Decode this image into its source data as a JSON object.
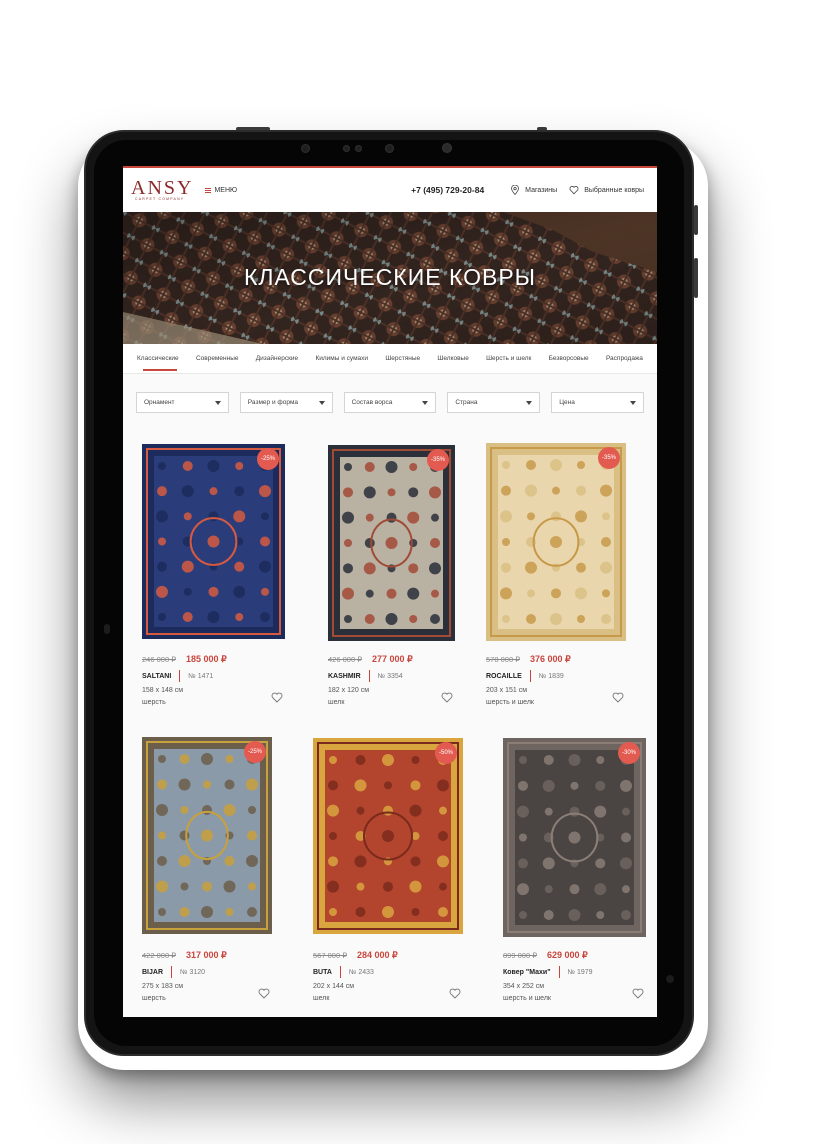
{
  "header": {
    "logo": "ANSY",
    "logo_sub": "CARPET COMPANY",
    "menu_label": "МЕНЮ",
    "phone": "+7 (495) 729-20-84",
    "stores_label": "Магазины",
    "favorites_label": "Выбранные ковры"
  },
  "hero": {
    "title": "КЛАССИЧЕСКИЕ КОВРЫ"
  },
  "categories": [
    "Классические",
    "Современные",
    "Дизайнерские",
    "Килимы и сумахи",
    "Шерстяные",
    "Шелковые",
    "Шерсть и шелк",
    "Безворсовые",
    "Распродажа"
  ],
  "active_category": "Классические",
  "filters": [
    "Орнамент",
    "Размер и форма",
    "Состав ворса",
    "Страна",
    "Цена"
  ],
  "products": [
    {
      "discount": "-25%",
      "old_price": "246 000 ₽",
      "price": "185 000 ₽",
      "name": "SALTANI",
      "number": "№ 1471",
      "size": "158 x 148 см",
      "material": "шерсть",
      "colors": {
        "field": "#2a3d7a",
        "border": "#1c2a5c",
        "accent": "#d65a3f"
      }
    },
    {
      "discount": "-35%",
      "old_price": "426 000 ₽",
      "price": "277 000 ₽",
      "name": "KASHMIR",
      "number": "№ 3354",
      "size": "182 x 120 см",
      "material": "шелк",
      "colors": {
        "field": "#b9b1a2",
        "border": "#2a2f3a",
        "accent": "#a14a36"
      }
    },
    {
      "discount": "-35%",
      "old_price": "578 000 ₽",
      "price": "376 000 ₽",
      "name": "ROCAILLE",
      "number": "№ 1839",
      "size": "203 x 151 см",
      "material": "шерсть и шелк",
      "colors": {
        "field": "#e9d6ad",
        "border": "#d9bf84",
        "accent": "#c79a4a"
      }
    },
    {
      "discount": "-25%",
      "old_price": "422 000 ₽",
      "price": "317 000 ₽",
      "name": "BIJAR",
      "number": "№ 3120",
      "size": "275 x 183 см",
      "material": "шерсть",
      "colors": {
        "field": "#8b9aa8",
        "border": "#6b5e4a",
        "accent": "#c8a03c"
      }
    },
    {
      "discount": "-50%",
      "old_price": "567 000 ₽",
      "price": "284 000 ₽",
      "name": "BUTA",
      "number": "№ 2433",
      "size": "202 x 144 см",
      "material": "шелк",
      "colors": {
        "field": "#b3452e",
        "border": "#d9a53f",
        "accent": "#7a2a1c"
      }
    },
    {
      "discount": "-30%",
      "old_price": "899 000 ₽",
      "price": "629 000 ₽",
      "name": "Ковер \"Махи\"",
      "number": "№ 1979",
      "size": "354 x 252 см",
      "material": "шерсть и шелк",
      "colors": {
        "field": "#4a4442",
        "border": "#6e6560",
        "accent": "#8a7e76"
      }
    }
  ]
}
